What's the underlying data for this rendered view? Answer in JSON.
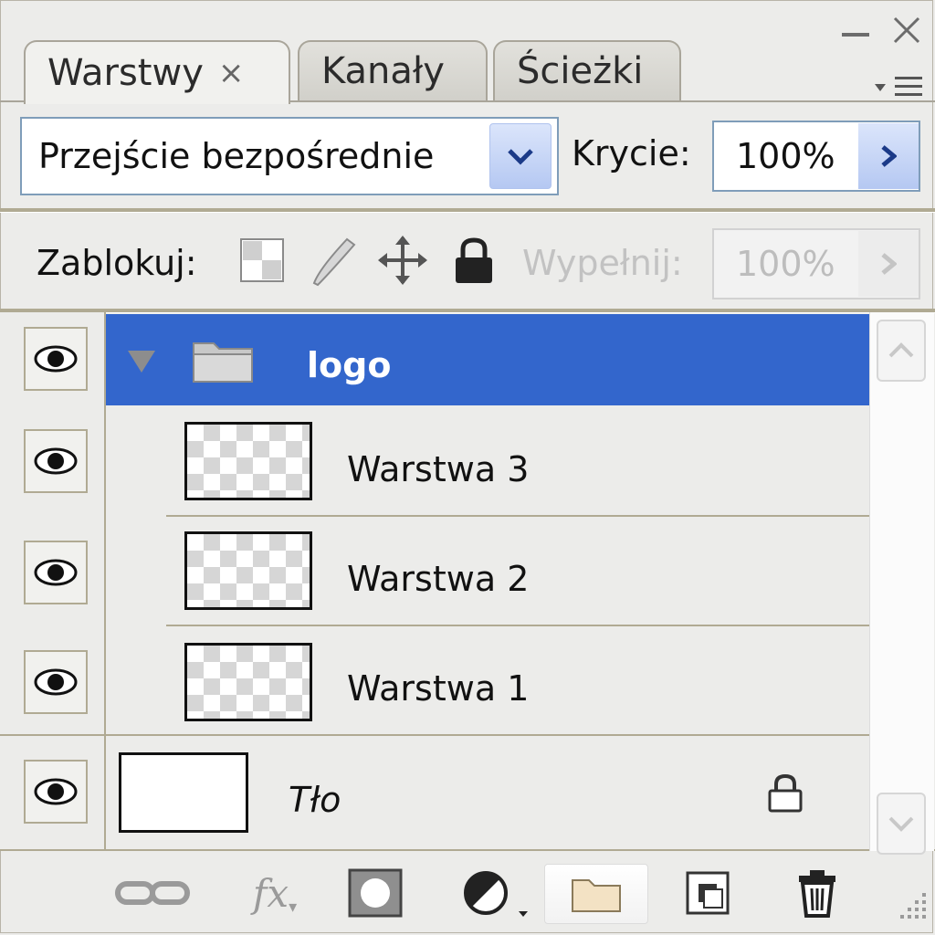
{
  "window": {
    "minimize_icon": "minimize-icon",
    "close_icon": "close-icon",
    "menu_icon": "panel-menu-icon"
  },
  "tabs": [
    {
      "label": "Warstwy",
      "active": true,
      "close": "×"
    },
    {
      "label": "Kanały",
      "active": false
    },
    {
      "label": "Ścieżki",
      "active": false
    }
  ],
  "blend_mode": {
    "value": "Przejście bezpośrednie"
  },
  "opacity": {
    "label": "Krycie:",
    "value": "100%"
  },
  "lock": {
    "label": "Zablokuj:",
    "icons": [
      "lock-transparent-icon",
      "lock-image-icon",
      "lock-position-icon",
      "lock-all-icon"
    ]
  },
  "fill": {
    "label": "Wypełnij:",
    "value": "100%"
  },
  "layers": [
    {
      "name": "logo",
      "type": "group",
      "expanded": true,
      "selected": true
    },
    {
      "name": "Warstwa 3",
      "type": "layer"
    },
    {
      "name": "Warstwa 2",
      "type": "layer"
    },
    {
      "name": "Warstwa 1",
      "type": "layer"
    },
    {
      "name": "Tło",
      "type": "background",
      "locked": true
    }
  ],
  "toolbar": [
    "link-layers-icon",
    "fx-icon",
    "mask-icon",
    "adjustment-icon",
    "new-group-icon",
    "new-layer-icon",
    "trash-icon"
  ],
  "toolbar_fx_label": "fx",
  "colors": {
    "selection": "#3366cc",
    "panel": "#ececea",
    "border": "#b0aa93"
  }
}
